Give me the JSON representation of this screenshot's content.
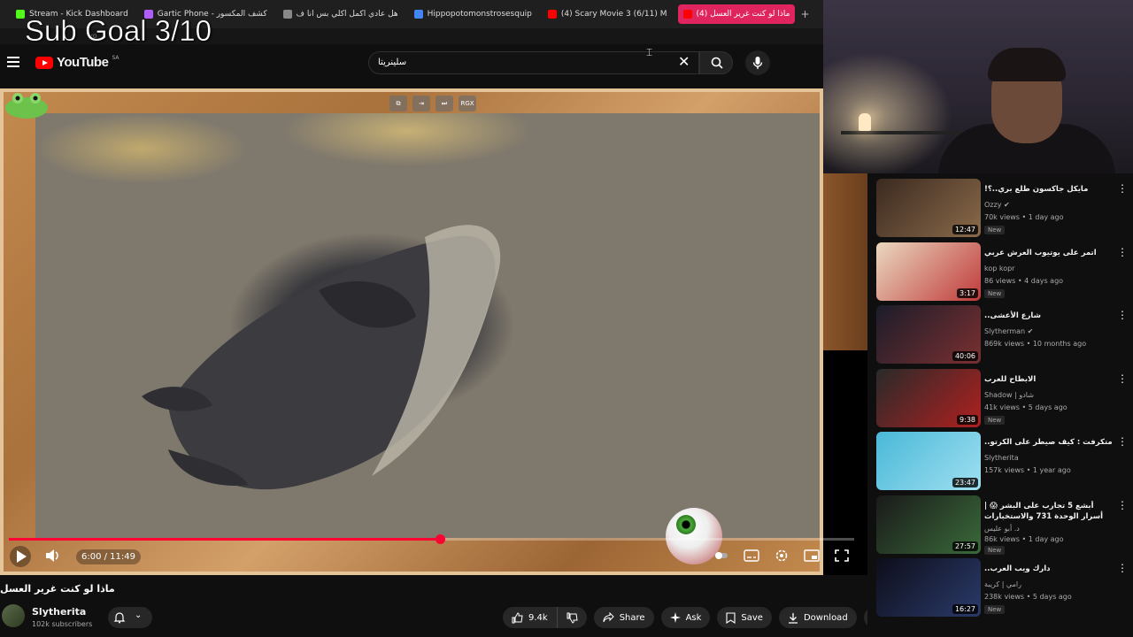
{
  "browser": {
    "tabs": [
      {
        "label": "Stream - Kick Dashboard",
        "color": "#53fc18"
      },
      {
        "label": "Gartic Phone - كشف المكسور",
        "color": "#b05cff"
      },
      {
        "label": "هل عادي اكمل اكلي بس انا ف",
        "color": "#888888"
      },
      {
        "label": "Hippopotomonstrosesquip",
        "color": "#4285f4"
      },
      {
        "label": "(4) Scary Movie 3 (6/11) M",
        "color": "#ff0000"
      },
      {
        "label": "(4) ماذا لو كنت غرير العسل",
        "color": "#ff0000",
        "active": true
      }
    ],
    "new_tab": "+",
    "address_fragment": "yo"
  },
  "overlay": {
    "sub_goal": "Sub Goal 3/10"
  },
  "youtube": {
    "logo": "YouTube",
    "country": "SA",
    "search_value": "سلينريتا",
    "clear": "✕"
  },
  "player": {
    "plugin_buttons": [
      "⧉",
      "⇥",
      "⏭",
      "RGX"
    ],
    "time": "6:00 / 11:49",
    "progress": 0.51
  },
  "video": {
    "title": "ماذا لو كنت غرير العسل",
    "channel": "Slytherita",
    "subscribers": "102k subscribers",
    "actions": {
      "like_count": "9.4k",
      "share": "Share",
      "ask": "Ask",
      "save": "Save",
      "download": "Download",
      "more": "⋯"
    }
  },
  "recommendations": [
    {
      "title": "مايكل جاكسون طلع بري..؟!",
      "channel": "Ozzy",
      "verified": true,
      "meta": "70k views • 1 day ago",
      "new": "New",
      "duration": "12:47",
      "thumb_a": "#3b2a20",
      "thumb_b": "#8a6a4a"
    },
    {
      "title": "اتمر على يوتيوب العرش عربي",
      "channel": "kop kopr",
      "verified": false,
      "meta": "86 views • 4 days ago",
      "new": "New",
      "duration": "3:17",
      "thumb_a": "#ead9c0",
      "thumb_b": "#c03a3a"
    },
    {
      "title": "شارع الأعشى..",
      "channel": "Slytherman",
      "verified": true,
      "meta": "869k views • 10 months ago",
      "new": "",
      "duration": "40:06",
      "thumb_a": "#1c1c2a",
      "thumb_b": "#7a3030"
    },
    {
      "title": "الابطاح للعرب",
      "channel": "Shadow | شادو",
      "verified": false,
      "meta": "41k views • 5 days ago",
      "new": "New",
      "duration": "9:38",
      "thumb_a": "#2a2a2a",
      "thumb_b": "#b02020"
    },
    {
      "title": "متكرفت : كيف صيطر على الكرتو..",
      "channel": "Slytherita",
      "verified": false,
      "meta": "157k views • 1 year ago",
      "new": "",
      "duration": "23:47",
      "thumb_a": "#4ab8d8",
      "thumb_b": "#9fe0f0"
    },
    {
      "title": "أبشع 5 تجارب على البشر 😱 | أسرار الوحدة 731 والاستخبارات الأمريكية!!",
      "channel": "د. أبو عليس",
      "verified": false,
      "meta": "86k views • 1 day ago",
      "new": "New",
      "duration": "27:57",
      "thumb_a": "#1a1a1a",
      "thumb_b": "#3a6a3a"
    },
    {
      "title": "دارك ويب العرب..",
      "channel": "رامي | كريبة",
      "verified": false,
      "meta": "238k views • 5 days ago",
      "new": "New",
      "duration": "16:27",
      "thumb_a": "#0e0e1a",
      "thumb_b": "#2a3a6a"
    }
  ]
}
